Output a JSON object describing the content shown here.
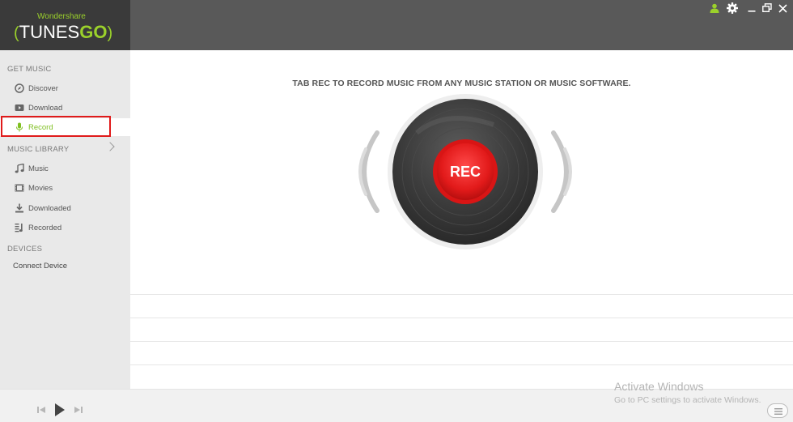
{
  "logo": {
    "brand": "Wondershare",
    "name_left": "TUNES",
    "name_right": "GO"
  },
  "sidebar": {
    "get_music_title": "GET MUSIC",
    "get_music_items": [
      {
        "label": "Discover",
        "icon": "compass-icon"
      },
      {
        "label": "Download",
        "icon": "play-box-icon"
      },
      {
        "label": "Record",
        "icon": "microphone-icon",
        "active": true
      }
    ],
    "music_library_title": "MUSIC LIBRARY",
    "music_library_items": [
      {
        "label": "Music",
        "icon": "music-note-icon"
      },
      {
        "label": "Movies",
        "icon": "film-icon"
      },
      {
        "label": "Downloaded",
        "icon": "download-icon"
      },
      {
        "label": "Recorded",
        "icon": "recorded-icon"
      }
    ],
    "devices_title": "DEVICES",
    "connect_device": "Connect Device"
  },
  "topbar": {
    "icons": [
      "user-icon",
      "gear-icon",
      "minimize-icon",
      "restore-icon",
      "close-icon"
    ]
  },
  "main": {
    "instruction": "TAB REC TO RECORD MUSIC FROM ANY MUSIC STATION OR MUSIC SOFTWARE.",
    "rec_label": "REC"
  },
  "overlay": {
    "activate_title": "Activate Windows",
    "activate_sub": "Go to PC settings to activate Windows."
  },
  "colors": {
    "accent": "#9bd12b",
    "rec_red": "#e21a1a",
    "highlight_border": "#e01a1a"
  }
}
